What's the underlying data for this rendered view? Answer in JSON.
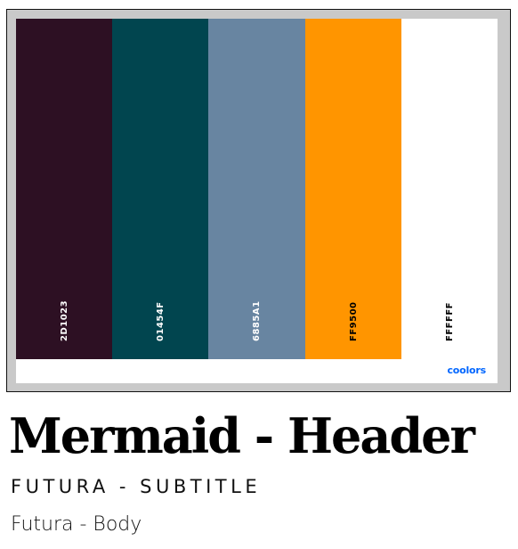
{
  "palette": {
    "swatches": [
      {
        "hex": "2D1023",
        "color": "#2D1023",
        "text_color": "#ffffff"
      },
      {
        "hex": "01454F",
        "color": "#01454F",
        "text_color": "#ffffff"
      },
      {
        "hex": "6885A1",
        "color": "#6885A1",
        "text_color": "#ffffff"
      },
      {
        "hex": "FF9500",
        "color": "#FF9500",
        "text_color": "#000000"
      },
      {
        "hex": "FFFFFF",
        "color": "#FFFFFF",
        "text_color": "#000000"
      }
    ],
    "brand": "coolors",
    "brand_color": "#0066ff"
  },
  "typography": {
    "header": "Mermaid - Header",
    "subtitle": "FUTURA - SUBTITLE",
    "body": "Futura - Body"
  }
}
